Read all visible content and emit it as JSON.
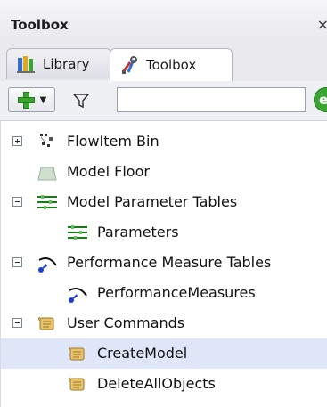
{
  "panel": {
    "title": "Toolbox",
    "close_glyph": "×"
  },
  "tabs": [
    {
      "label": "Library",
      "icon": "library-icon"
    },
    {
      "label": "Toolbox",
      "icon": "toolbox-icon"
    }
  ],
  "toolbar": {
    "add_dropdown_caret": "▼",
    "search_value": "",
    "search_placeholder": "",
    "go_glyph": "e"
  },
  "tree": [
    {
      "label": "FlowItem Bin",
      "level": 0,
      "expander": "plus",
      "icon": "flowitem-bin-icon"
    },
    {
      "label": "Model Floor",
      "level": 0,
      "expander": "none",
      "icon": "model-floor-icon"
    },
    {
      "label": "Model Parameter Tables",
      "level": 0,
      "expander": "minus",
      "icon": "parameter-table-icon"
    },
    {
      "label": "Parameters",
      "level": 1,
      "expander": "none",
      "icon": "parameter-table-icon"
    },
    {
      "label": "Performance Measure Tables",
      "level": 0,
      "expander": "minus",
      "icon": "performance-measure-icon"
    },
    {
      "label": "PerformanceMeasures",
      "level": 1,
      "expander": "none",
      "icon": "performance-measure-icon"
    },
    {
      "label": "User Commands",
      "level": 0,
      "expander": "minus",
      "icon": "scroll-icon"
    },
    {
      "label": "CreateModel",
      "level": 1,
      "expander": "none",
      "icon": "scroll-icon",
      "selected": true
    },
    {
      "label": "DeleteAllObjects",
      "level": 1,
      "expander": "none",
      "icon": "scroll-icon"
    }
  ],
  "colors": {
    "selection": "#dfe6f7",
    "accent_green": "#3aa632"
  }
}
